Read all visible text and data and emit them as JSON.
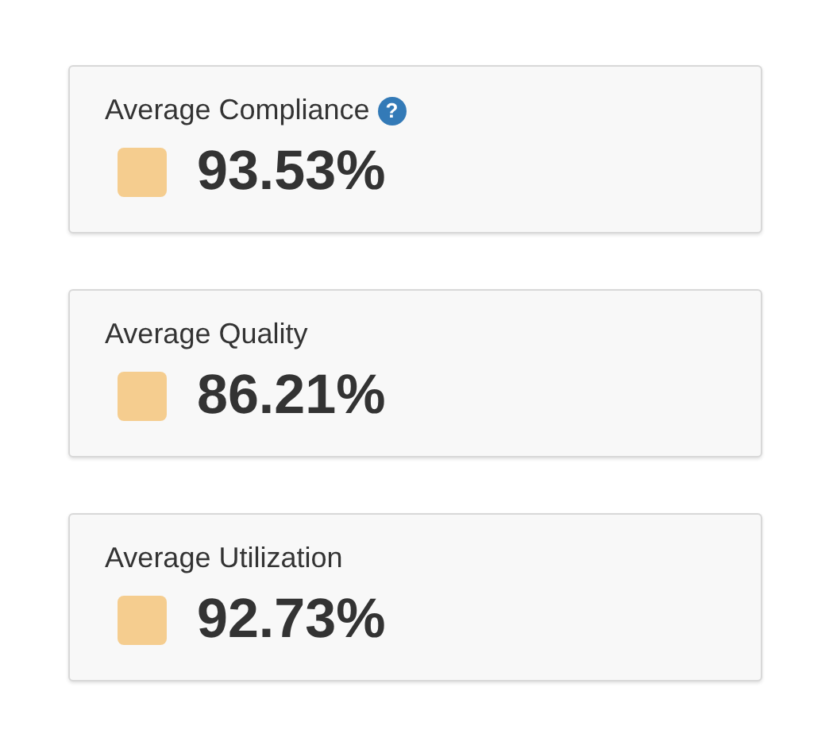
{
  "metrics": [
    {
      "title": "Average Compliance",
      "help_icon": "?",
      "color": "#f5cd8f",
      "value": "93.53%"
    },
    {
      "title": "Average Quality",
      "color": "#f5cd8f",
      "value": "86.21%"
    },
    {
      "title": "Average Utilization",
      "color": "#f5cd8f",
      "value": "92.73%"
    }
  ]
}
